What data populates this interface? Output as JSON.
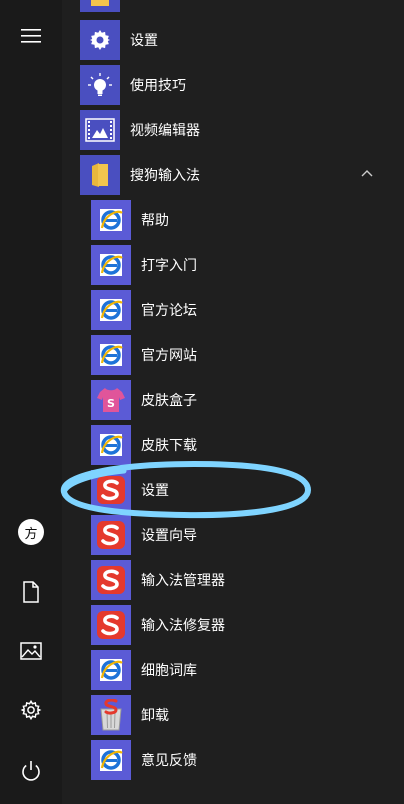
{
  "colors": {
    "tile_blue": "#4a4fc0",
    "tile_purple": "#5b5bd6",
    "ie_blue": "#1e73d8",
    "ie_yellow": "#f2b705",
    "sogou_red": "#e4392d",
    "folder_yellow": "#f3c54d",
    "highlight_cyan": "#7fd4ff"
  },
  "rail": {
    "items": [
      {
        "icon": "hamburger-menu-icon"
      },
      {
        "icon": "user-avatar-icon",
        "text": "方"
      },
      {
        "icon": "document-icon"
      },
      {
        "icon": "picture-icon"
      },
      {
        "icon": "gear-icon"
      },
      {
        "icon": "power-icon"
      }
    ]
  },
  "menu": {
    "items": [
      {
        "label": "设置",
        "icon": "gear-tile-icon"
      },
      {
        "label": "使用技巧",
        "icon": "lightbulb-icon"
      },
      {
        "label": "视频编辑器",
        "icon": "video-editor-icon"
      },
      {
        "label": "搜狗输入法",
        "icon": "folder-icon",
        "expanded": true
      },
      {
        "label": "帮助",
        "icon": "ie-icon"
      },
      {
        "label": "打字入门",
        "icon": "ie-icon"
      },
      {
        "label": "官方论坛",
        "icon": "ie-icon"
      },
      {
        "label": "官方网站",
        "icon": "ie-icon"
      },
      {
        "label": "皮肤盒子",
        "icon": "skin-box-icon"
      },
      {
        "label": "皮肤下载",
        "icon": "ie-icon"
      },
      {
        "label": "设置",
        "icon": "sogou-icon"
      },
      {
        "label": "设置向导",
        "icon": "sogou-icon"
      },
      {
        "label": "输入法管理器",
        "icon": "sogou-icon"
      },
      {
        "label": "输入法修复器",
        "icon": "sogou-icon"
      },
      {
        "label": "细胞词库",
        "icon": "ie-icon"
      },
      {
        "label": "卸载",
        "icon": "uninstall-icon"
      },
      {
        "label": "意见反馈",
        "icon": "ie-icon"
      }
    ]
  }
}
